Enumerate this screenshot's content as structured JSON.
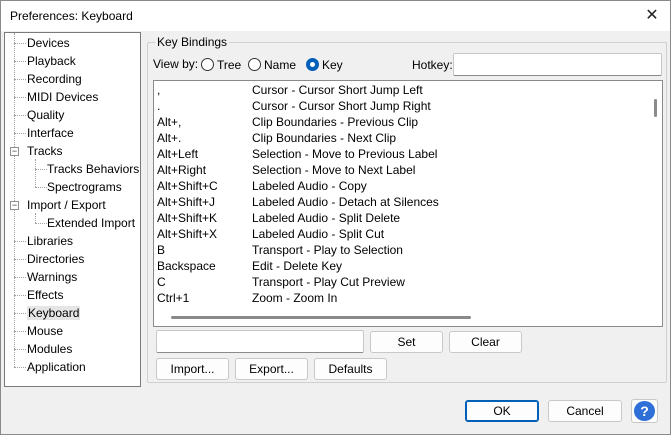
{
  "window": {
    "title": "Preferences: Keyboard",
    "close_glyph": "✕"
  },
  "tree": {
    "items": [
      {
        "label": "Devices"
      },
      {
        "label": "Playback"
      },
      {
        "label": "Recording"
      },
      {
        "label": "MIDI Devices"
      },
      {
        "label": "Quality"
      },
      {
        "label": "Interface"
      },
      {
        "label": "Tracks"
      },
      {
        "label": "Tracks Behaviors"
      },
      {
        "label": "Spectrograms"
      },
      {
        "label": "Import / Export"
      },
      {
        "label": "Extended Import"
      },
      {
        "label": "Libraries"
      },
      {
        "label": "Directories"
      },
      {
        "label": "Warnings"
      },
      {
        "label": "Effects"
      },
      {
        "label": "Keyboard"
      },
      {
        "label": "Mouse"
      },
      {
        "label": "Modules"
      },
      {
        "label": "Application"
      }
    ],
    "selected": "Keyboard",
    "collapse_glyph": "−"
  },
  "key_bindings": {
    "group_label": "Key Bindings",
    "view_by_label": "View by:",
    "view_options": [
      "Tree",
      "Name",
      "Key"
    ],
    "view_selected": "Key",
    "hotkey_label": "Hotkey:",
    "hotkey_value": "",
    "rows": [
      {
        "key": ",",
        "action": "Cursor - Cursor Short Jump Left"
      },
      {
        "key": ".",
        "action": "Cursor - Cursor Short Jump Right"
      },
      {
        "key": "Alt+,",
        "action": "Clip Boundaries - Previous Clip"
      },
      {
        "key": "Alt+.",
        "action": "Clip Boundaries - Next Clip"
      },
      {
        "key": "Alt+Left",
        "action": "Selection - Move to Previous Label"
      },
      {
        "key": "Alt+Right",
        "action": "Selection - Move to Next Label"
      },
      {
        "key": "Alt+Shift+C",
        "action": "Labeled Audio - Copy"
      },
      {
        "key": "Alt+Shift+J",
        "action": "Labeled Audio - Detach at Silences"
      },
      {
        "key": "Alt+Shift+K",
        "action": "Labeled Audio - Split Delete"
      },
      {
        "key": "Alt+Shift+X",
        "action": "Labeled Audio - Split Cut"
      },
      {
        "key": "B",
        "action": "Transport - Play to Selection"
      },
      {
        "key": "Backspace",
        "action": "Edit - Delete Key"
      },
      {
        "key": "C",
        "action": "Transport - Play Cut Preview"
      },
      {
        "key": "Ctrl+1",
        "action": "Zoom - Zoom In"
      }
    ],
    "key_input_value": "",
    "set_label": "Set",
    "clear_label": "Clear",
    "import_label": "Import...",
    "export_label": "Export...",
    "defaults_label": "Defaults"
  },
  "footer": {
    "ok_label": "OK",
    "cancel_label": "Cancel",
    "help_glyph": "?"
  },
  "colors": {
    "accent": "#005fb8",
    "help": "#2f6fd8",
    "selected_bg": "#e5e5e5"
  }
}
